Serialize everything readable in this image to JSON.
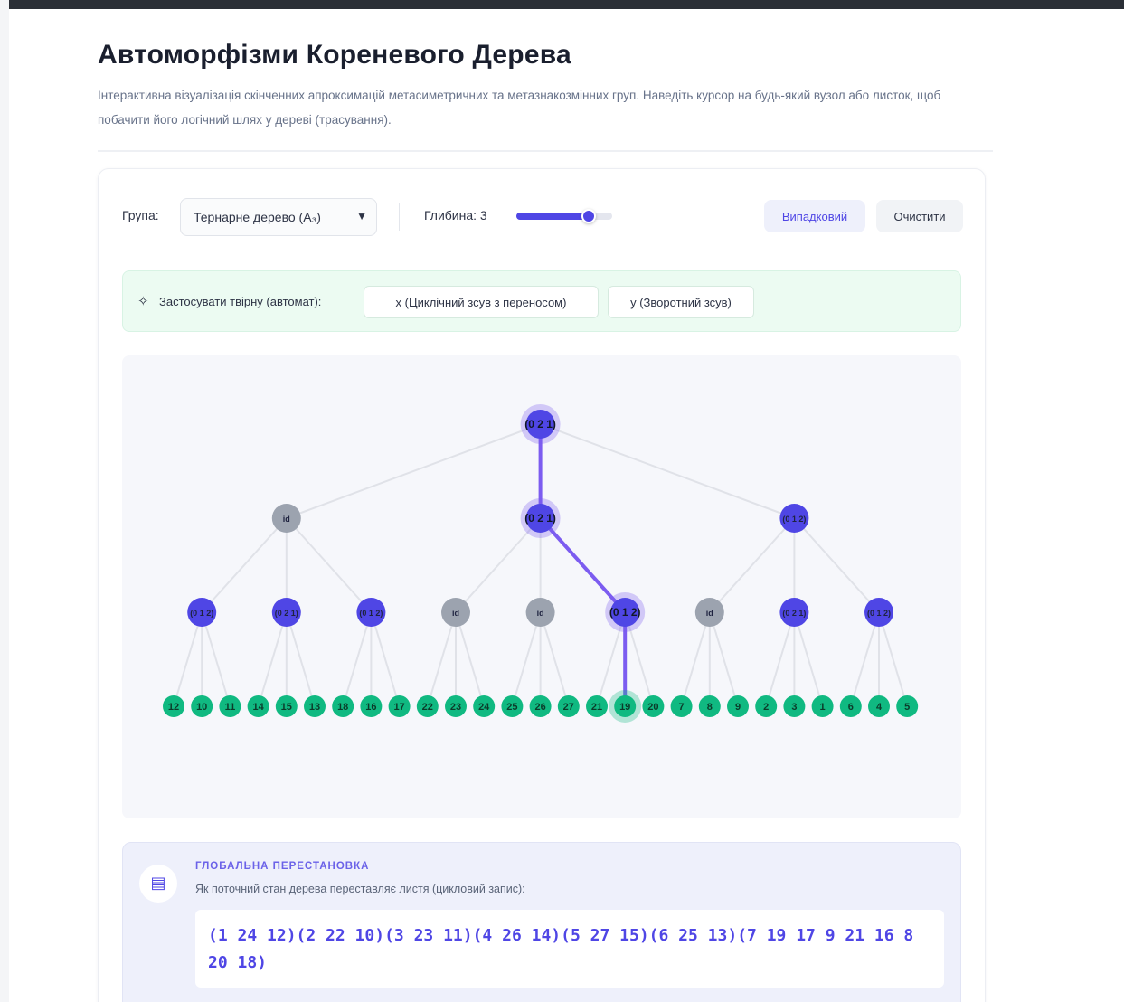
{
  "header": {
    "title": "Автоморфізми Кореневого Дерева",
    "subtitle": "Інтерактивна візуалізація скінченних апроксимацій метасиметричних та метазнакозмінних груп. Наведіть курсор на будь-який вузол або листок, щоб побачити його логічний шлях у дереві (трасування)."
  },
  "toolbar": {
    "group_label": "Група:",
    "group_value": "Тернарне дерево (A₃)",
    "depth_label": "Глибина: 3",
    "depth_value": 3,
    "depth_max": 4,
    "random_label": "Випадковий",
    "clear_label": "Очистити"
  },
  "generators": {
    "icon": "sparkle-icon",
    "label": "Застосувати твірну (автомат):",
    "x_label": "x (Циклічний зсув з переносом)",
    "y_label": "y (Зворотний зсув)"
  },
  "tree": {
    "root": "(0 2 1)",
    "level1": [
      "id",
      "(0 2 1)",
      "(0 1 2)"
    ],
    "level2": [
      "(0 1 2)",
      "(0 2 1)",
      "(0 1 2)",
      "id",
      "id",
      "(0 1 2)",
      "id",
      "(0 2 1)",
      "(0 1 2)"
    ],
    "leaves": [
      "12",
      "10",
      "11",
      "14",
      "15",
      "13",
      "18",
      "16",
      "17",
      "22",
      "23",
      "24",
      "25",
      "26",
      "27",
      "21",
      "19",
      "20",
      "7",
      "8",
      "9",
      "2",
      "3",
      "1",
      "6",
      "4",
      "5"
    ],
    "highlight_path": [
      1,
      5,
      16
    ],
    "colors": {
      "active": "#4f46e5",
      "identity": "#9ca3af",
      "leaf": "#10b981",
      "edge": "#e0e2e8",
      "path": "#7c5cf0"
    }
  },
  "permutation": {
    "icon": "document-icon",
    "title": "ГЛОБАЛЬНА ПЕРЕСТАНОВКА",
    "description": "Як поточний стан дерева переставляє листя (цикловий запис):",
    "cycles": "(1 24 12)(2 22 10)(3 23 11)(4 26 14)(5 27 15)(6 25 13)(7 19 17 9 21 16 8 20 18)"
  }
}
